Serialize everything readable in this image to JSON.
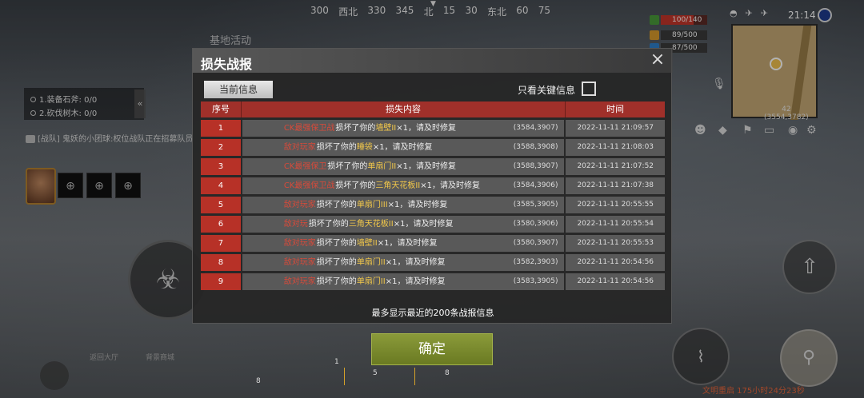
{
  "compass": {
    "labels": [
      "300",
      "西北",
      "330",
      "345",
      "北",
      "15",
      "30",
      "东北",
      "60",
      "75"
    ]
  },
  "hud": {
    "base_activity_tab": "基地活动",
    "quests": [
      {
        "label": "1.装备石斧: 0/0"
      },
      {
        "label": "2.砍伐树木: 0/0"
      }
    ],
    "quests_toggle": "«",
    "team_chat": "[战队] 鬼妖的小团球:权位战队正在招募队员",
    "clock": "21:14",
    "stats": {
      "health": "100/140",
      "hunger": "89/500",
      "water": "87/500"
    },
    "map_coords_top": "42",
    "map_coords": "(3554,3782)",
    "bottom_slot_number": "8",
    "bottom_numbers": [
      "1",
      "5",
      "8"
    ],
    "timer_text": "文明重启 175小时24分23秒",
    "bottom_left_buttons": [
      "返回大厅",
      "背景商城"
    ]
  },
  "dialog": {
    "title": "损失战报",
    "close_icon": "×",
    "current_tab": "当前信息",
    "filter_label": "只看关键信息",
    "filter_checked": false,
    "columns": [
      "序号",
      "损失内容",
      "时间"
    ],
    "rows": [
      {
        "no": "1",
        "attacker": "CK最强保卫战",
        "verb": "损坏了你的",
        "item": "墙壁II",
        "suffix": "×1，请及时修复",
        "pos": "(3584,3907)",
        "time": "2022-11-11 21:09:57"
      },
      {
        "no": "2",
        "attacker": "敌对玩家",
        "verb": "损坏了你的",
        "item": "睡袋",
        "suffix": "×1，请及时修复",
        "pos": "(3588,3908)",
        "time": "2022-11-11 21:08:03"
      },
      {
        "no": "3",
        "attacker": "CK最强保卫",
        "verb": "损坏了你的",
        "item": "单扇门II",
        "suffix": "×1，请及时修复",
        "pos": "(3588,3907)",
        "time": "2022-11-11 21:07:52"
      },
      {
        "no": "4",
        "attacker": "CK最强保卫战",
        "verb": "损坏了你的",
        "item": "三角天花板II",
        "suffix": "×1，请及时修复",
        "pos": "(3584,3906)",
        "time": "2022-11-11 21:07:38"
      },
      {
        "no": "5",
        "attacker": "敌对玩家",
        "verb": "损坏了你的",
        "item": "单扇门III",
        "suffix": "×1，请及时修复",
        "pos": "(3585,3905)",
        "time": "2022-11-11 20:55:55"
      },
      {
        "no": "6",
        "attacker": "敌对玩",
        "verb": "损坏了你的",
        "item": "三角天花板II",
        "suffix": "×1，请及时修复",
        "pos": "(3580,3906)",
        "time": "2022-11-11 20:55:54"
      },
      {
        "no": "7",
        "attacker": "敌对玩家",
        "verb": "损坏了你的",
        "item": "墙壁II",
        "suffix": "×1，请及时修复",
        "pos": "(3580,3907)",
        "time": "2022-11-11 20:55:53"
      },
      {
        "no": "8",
        "attacker": "敌对玩家",
        "verb": "损坏了你的",
        "item": "单扇门II",
        "suffix": "×1，请及时修复",
        "pos": "(3582,3903)",
        "time": "2022-11-11 20:54:56"
      },
      {
        "no": "9",
        "attacker": "敌对玩家",
        "verb": "损坏了你的",
        "item": "单扇门II",
        "suffix": "×1，请及时修复",
        "pos": "(3583,3905)",
        "time": "2022-11-11 20:54:56"
      }
    ],
    "footnote": "最多显示最近的200条战报信息"
  },
  "confirm_label": "确定",
  "colors": {
    "header_red": "#a0302a",
    "index_red": "#b73127",
    "attacker_red": "#d84a3a",
    "item_yellow": "#f2c84a",
    "confirm_green": "#7a8a2e"
  }
}
